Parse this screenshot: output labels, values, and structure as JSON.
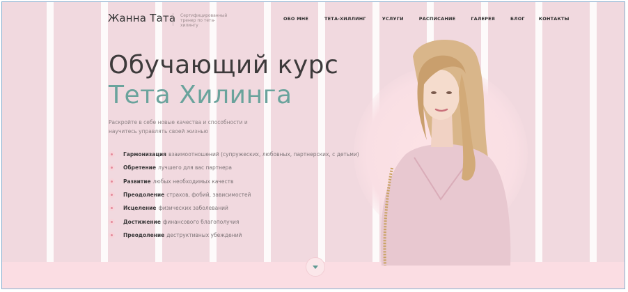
{
  "header": {
    "logo": "Жанна Тата",
    "tagline": "Сертифицированный тренер по тета-хилингу",
    "nav": [
      "ОБО МНЕ",
      "ТЕТА-ХИЛЛИНГ",
      "УСЛУГИ",
      "РАСПИСАНИЕ",
      "ГАЛЕРЕЯ",
      "БЛОГ",
      "КОНТАКТЫ"
    ]
  },
  "hero": {
    "title_line1": "Обучающий курс",
    "title_line2": "Тета Хилинга",
    "lead": "Раскройте в себе новые качества и способности и научитесь управлять своей жизнью",
    "benefits": [
      {
        "bold": "Гармонизация",
        "text": "взаимоотношений (супружеских, любовных, партнерских, с детьми)"
      },
      {
        "bold": "Обретение",
        "text": "лучшего для вас партнера"
      },
      {
        "bold": "Развитие",
        "text": "любых необходимых качеств"
      },
      {
        "bold": "Преодоление",
        "text": "страхов, фобий, зависимостей"
      },
      {
        "bold": "Исцеление",
        "text": "физических заболеваний"
      },
      {
        "bold": "Достижение",
        "text": "финансового благополучия"
      },
      {
        "bold": "Преодоление",
        "text": "деструктивных убеждений"
      }
    ]
  },
  "icons": {
    "scroll": "chevron-down-icon",
    "bullet": "dot-icon"
  },
  "colors": {
    "accent": "#6aa39c",
    "background": "#f1d9df",
    "heading": "#3d3a3b",
    "bullet": "#e58a9a"
  }
}
